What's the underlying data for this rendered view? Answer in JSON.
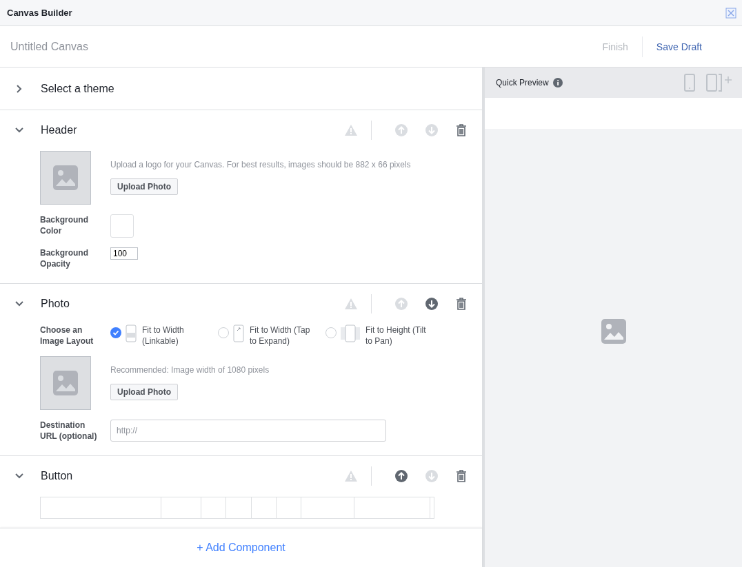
{
  "window": {
    "title": "Canvas Builder"
  },
  "toolbar": {
    "canvas_name": "Untitled Canvas",
    "finish": {
      "label": "Finish",
      "disabled": true
    },
    "save_draft": {
      "label": "Save Draft",
      "disabled": false
    }
  },
  "theme": {
    "label": "Select a theme",
    "expanded": false
  },
  "sections": [
    {
      "kind": "header",
      "title": "Header",
      "expanded": true,
      "move_up_disabled": true,
      "move_down_disabled": true,
      "hint": "Upload a logo for your Canvas. For best results, images should be 882 x 66 pixels",
      "upload": "Upload Photo",
      "color_label": "Background Color",
      "opacity_label": "Background Opacity",
      "opacity_value": "100"
    },
    {
      "kind": "photo",
      "title": "Photo",
      "expanded": true,
      "move_up_disabled": true,
      "move_down_disabled": false,
      "layout_label": "Choose an Image Layout",
      "layouts": [
        {
          "label": "Fit to Width (Linkable)",
          "selected": true
        },
        {
          "label": "Fit to Width (Tap to Expand)",
          "selected": false
        },
        {
          "label": "Fit to Height (Tilt to Pan)",
          "selected": false
        }
      ],
      "hint": "Recommended: Image width of 1080 pixels",
      "upload": "Upload Photo",
      "url_label": "Destination URL (optional)",
      "url_placeholder": "http://"
    },
    {
      "kind": "button",
      "title": "Button",
      "expanded": true,
      "move_up_disabled": false,
      "move_down_disabled": true
    }
  ],
  "add_component": "+ Add Component",
  "preview": {
    "title": "Quick Preview"
  }
}
